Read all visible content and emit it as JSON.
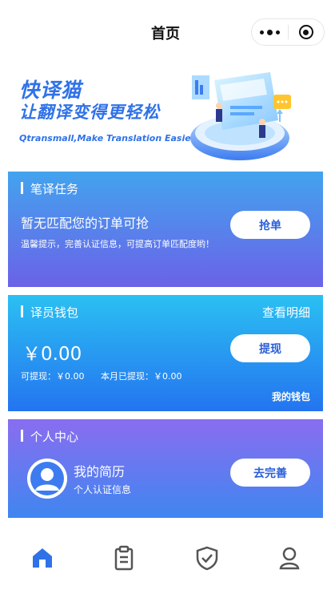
{
  "header": {
    "title": "首页"
  },
  "banner": {
    "brand": "快译猫",
    "slogan": "让翻译变得更轻松",
    "english": "Qtransmall,Make Translation Easier"
  },
  "task_card": {
    "title": "笔译任务",
    "main_text": "暂无匹配您的订单可抢",
    "tip": "温馨提示，完善认证信息，可提高订单匹配度哟！",
    "button": "抢单"
  },
  "wallet_card": {
    "title": "译员钱包",
    "detail_link": "查看明细",
    "amount": "￥0.00",
    "button": "提现",
    "available": "可提现：￥0.00",
    "month_withdrawn": "本月已提现：￥0.00",
    "my_wallet": "我的钱包"
  },
  "profile_card": {
    "title": "个人中心",
    "resume": "我的简历",
    "cert": "个人认证信息",
    "button": "去完善"
  },
  "tabbar": {
    "items": [
      {
        "icon": "home-icon",
        "active": true
      },
      {
        "icon": "orders-icon",
        "active": false
      },
      {
        "icon": "certification-icon",
        "active": false
      },
      {
        "icon": "profile-icon",
        "active": false
      }
    ]
  },
  "colors": {
    "accent": "#2f72e8",
    "task_gradient": [
      "#43a3ee",
      "#6b62e8"
    ],
    "wallet_gradient": [
      "#2bc0f2",
      "#2474f0"
    ],
    "profile_gradient": [
      "#8a6df0",
      "#3f86f0"
    ]
  }
}
